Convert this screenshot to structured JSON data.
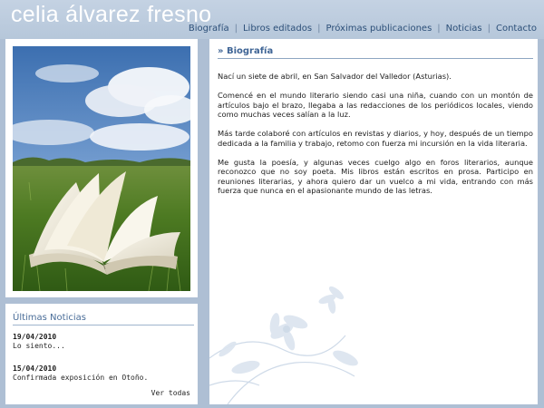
{
  "site": {
    "title": "celia álvarez fresno"
  },
  "nav": [
    {
      "label": "Biografía"
    },
    {
      "label": "Libros editados"
    },
    {
      "label": "Próximas publicaciones"
    },
    {
      "label": "Noticias"
    },
    {
      "label": "Contacto"
    }
  ],
  "section": {
    "heading": "» Biografía"
  },
  "bio": [
    "Nací un siete de abril, en San Salvador del Valledor (Asturias).",
    "Comencé en el mundo literario siendo casi una niña, cuando con un montón de artículos bajo el brazo, llegaba a las redacciones de los periódicos locales, viendo como muchas veces salían a la luz.",
    "Más tarde colaboré con artículos en revistas y diarios, y hoy, después de un tiempo dedicada a la familia y trabajo, retomo con fuerza mi incursión en la vida literaria.",
    "Me gusta la poesía, y algunas veces cuelgo algo en foros literarios, aunque reconozco que no soy poeta. Mis libros están escritos en prosa. Participo en reuniones literarias, y ahora quiero dar un vuelco a mi vida, entrando con más fuerza que nunca en el apasionante mundo de las letras."
  ],
  "news": {
    "title": "Últimas Noticias",
    "items": [
      {
        "date": "19/04/2010",
        "text": "Lo siento..."
      },
      {
        "date": "15/04/2010",
        "text": "Confirmada exposición en Otoño."
      }
    ],
    "see_all": "Ver todas"
  },
  "photo": {
    "icon": "open-book-on-grass-photo"
  },
  "colors": {
    "background": "#aebfd4",
    "heading": "#3f6596",
    "nav": "#2c4f78"
  }
}
